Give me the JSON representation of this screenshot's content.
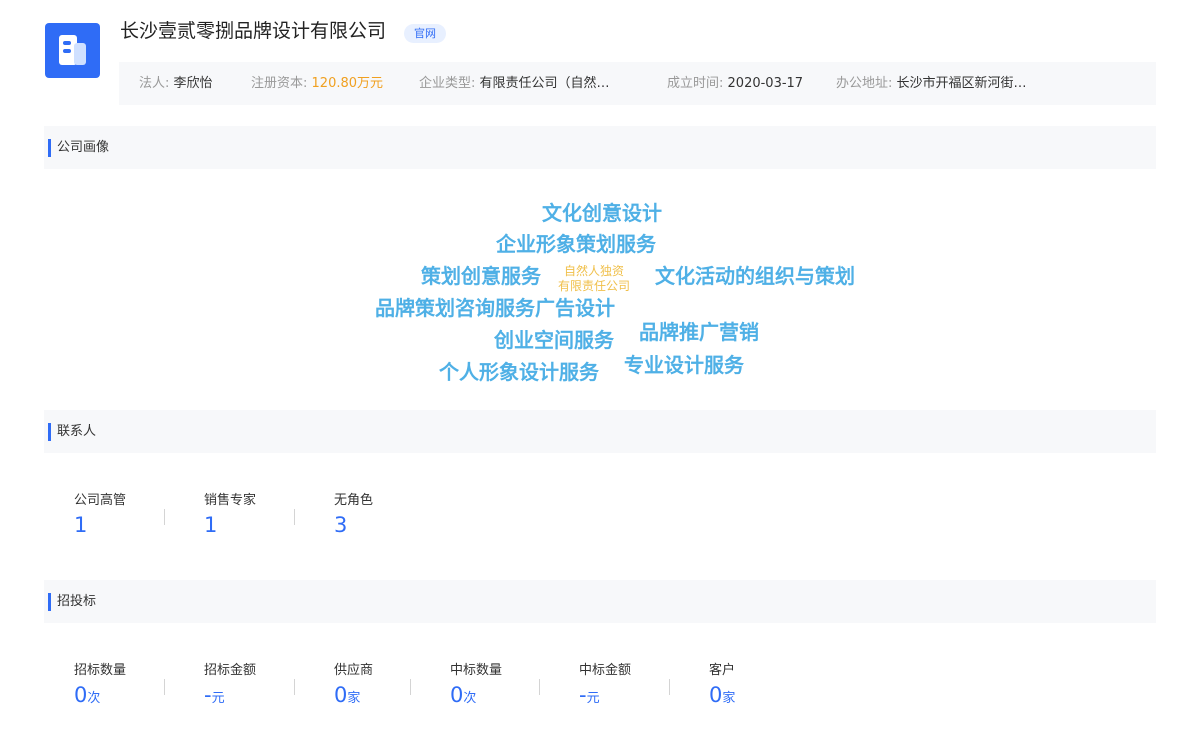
{
  "header": {
    "company_name": "长沙壹贰零捌品牌设计有限公司",
    "official_tag": "官网",
    "logo_icon": "building-icon",
    "info": [
      {
        "label": "法人:",
        "value": "李欣怡"
      },
      {
        "label": "注册资本:",
        "value": "120.80万元"
      },
      {
        "label": "企业类型:",
        "value": "有限责任公司（自然…"
      },
      {
        "label": "成立时间:",
        "value": "2020-03-17"
      },
      {
        "label": "办公地址:",
        "value": "长沙市开福区新河街…"
      }
    ]
  },
  "portrait": {
    "title": "公司画像",
    "center_tag_line1": "自然人独资",
    "center_tag_line2": "有限责任公司",
    "words": [
      "文化创意设计",
      "企业形象策划服务",
      "策划创意服务",
      "文化活动的组织与策划",
      "品牌策划咨询服务广告设计",
      "创业空间服务",
      "品牌推广营销",
      "个人形象设计服务",
      "专业设计服务"
    ]
  },
  "contacts": {
    "title": "联系人",
    "stats": [
      {
        "label": "公司高管",
        "value": "1"
      },
      {
        "label": "销售专家",
        "value": "1"
      },
      {
        "label": "无角色",
        "value": "3"
      }
    ]
  },
  "bidding": {
    "title": "招投标",
    "stats": [
      {
        "label": "招标数量",
        "value": "0",
        "unit": "次"
      },
      {
        "label": "招标金额",
        "value": "-",
        "unit": "元"
      },
      {
        "label": "供应商",
        "value": "0",
        "unit": "家"
      },
      {
        "label": "中标数量",
        "value": "0",
        "unit": "次"
      },
      {
        "label": "中标金额",
        "value": "-",
        "unit": "元"
      },
      {
        "label": "客户",
        "value": "0",
        "unit": "家"
      }
    ]
  },
  "colors": {
    "accent": "#2f6cf6",
    "word_cloud": "#4fb0e6",
    "center_tag": "#f0c04c",
    "money": "#f0a020"
  }
}
